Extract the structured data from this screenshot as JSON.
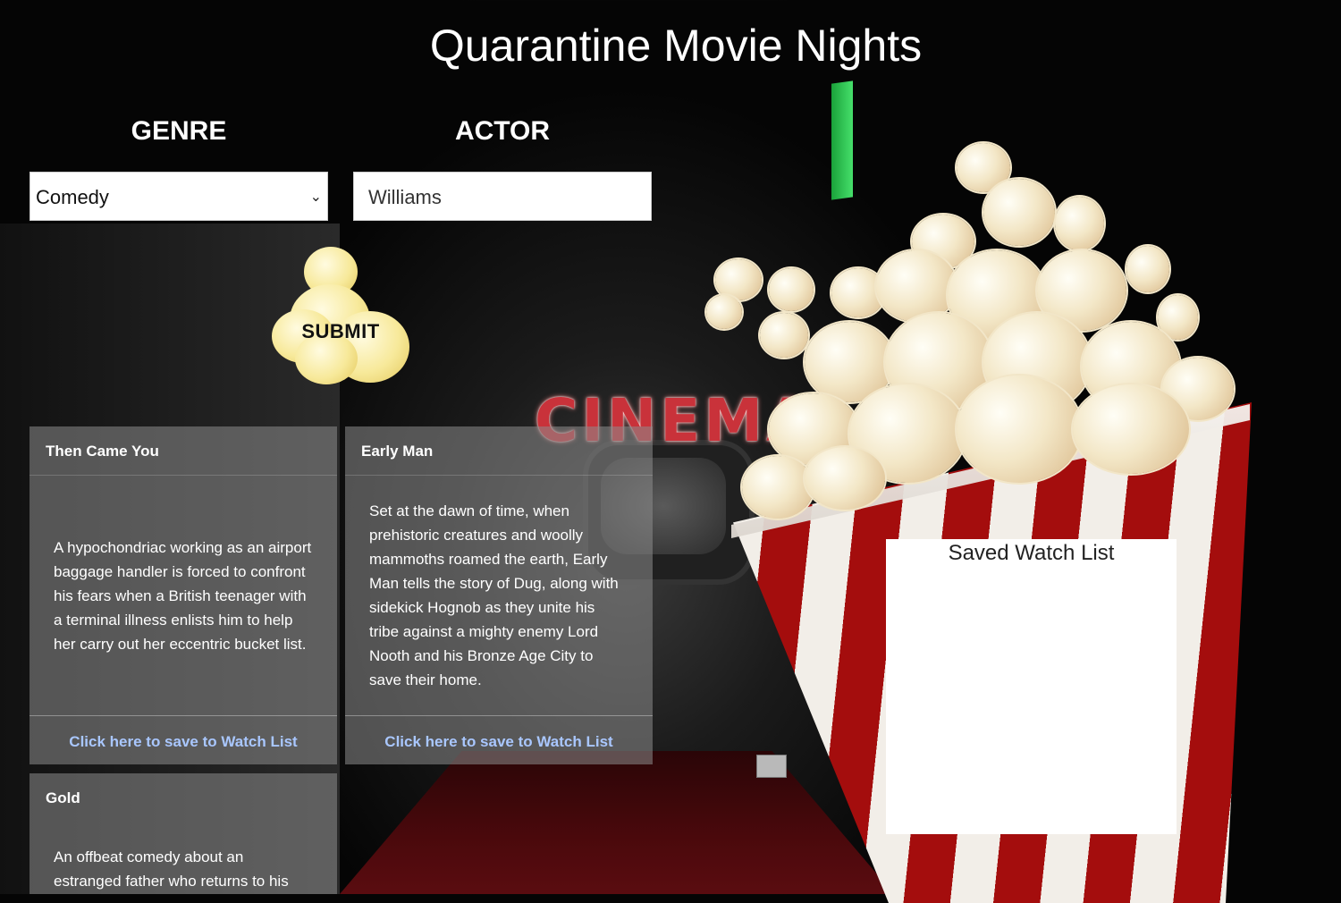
{
  "app": {
    "title": "Quarantine Movie Nights"
  },
  "form": {
    "genre_label": "GENRE",
    "genre_selected": "Comedy",
    "actor_label": "ACTOR",
    "actor_value": "Williams",
    "submit_label": "SUBMIT"
  },
  "scenery": {
    "cinema_sign": "CINEMA"
  },
  "movies": [
    {
      "title": "Then Came You",
      "description": "A hypochondriac working as an airport baggage handler is forced to confront his fears when a British teenager with a terminal illness enlists him to help her carry out her eccentric bucket list.",
      "save_link": "Click here to save to Watch List"
    },
    {
      "title": "Early Man",
      "description": "Set at the dawn of time, when prehistoric creatures and woolly mammoths roamed the earth, Early Man tells the story of Dug, along with sidekick Hognob as they unite his tribe against a mighty enemy Lord Nooth and his Bronze Age City to save their home.",
      "save_link": "Click here to save to Watch List"
    },
    {
      "title": "Gold",
      "description": "An offbeat comedy about an estranged father who returns to his"
    }
  ],
  "watch_list": {
    "title": "Saved Watch List"
  },
  "colors": {
    "link": "#a9c7ff",
    "bucket_red": "#a40d0d",
    "card_bg": "rgba(140,140,140,0.55)"
  }
}
